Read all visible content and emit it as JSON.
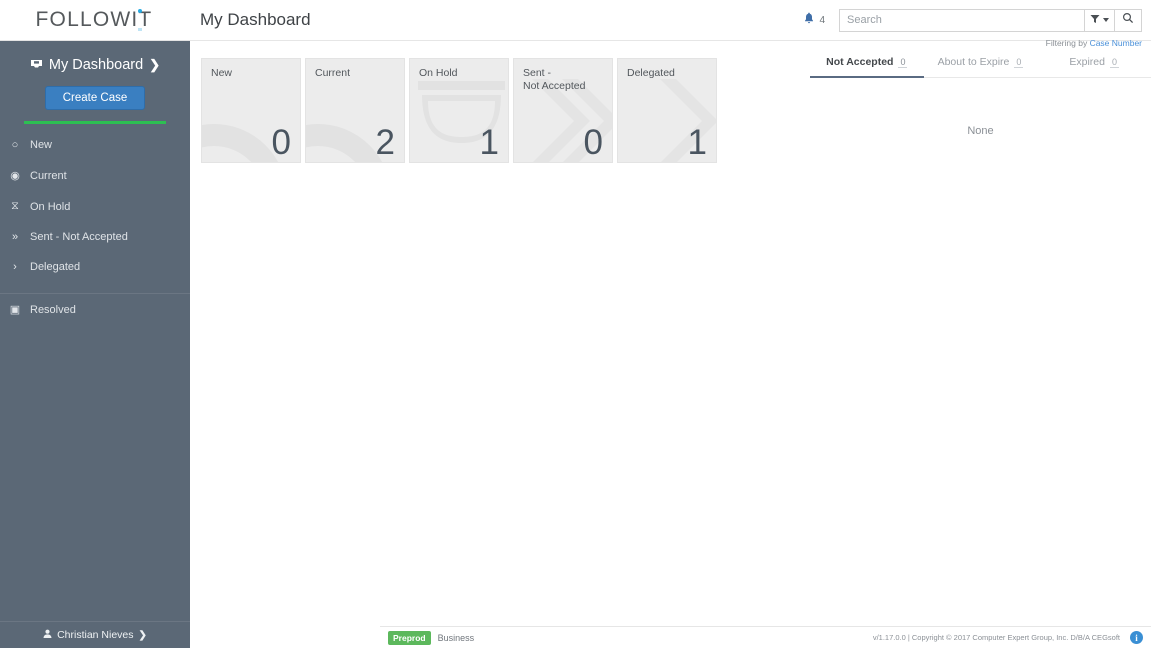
{
  "brand": {
    "logo_text": "FOLLOWIT",
    "accent_color": "#29abe2"
  },
  "sidebar": {
    "dashboard_label": "My Dashboard",
    "dashboard_icon": "inbox-icon",
    "dashboard_chevron": "❯",
    "create_button": "Create Case",
    "items": [
      {
        "label": "New",
        "icon": "circle-outline-icon",
        "glyph": "○"
      },
      {
        "label": "Current",
        "icon": "target-icon",
        "glyph": "◉"
      },
      {
        "label": "On Hold",
        "icon": "hourglass-icon",
        "glyph": "⧖"
      },
      {
        "label": "Sent - Not Accepted",
        "icon": "double-chevron-right-icon",
        "glyph": "»"
      },
      {
        "label": "Delegated",
        "icon": "chevron-right-icon",
        "glyph": "›"
      }
    ],
    "resolved": {
      "label": "Resolved",
      "icon": "archive-box-icon",
      "glyph": "▣"
    },
    "user": {
      "name": "Christian Nieves",
      "icon": "user-icon",
      "chevron": "❯"
    }
  },
  "header": {
    "title": "My Dashboard",
    "notifications": {
      "icon": "bell-icon",
      "count": "4"
    },
    "search": {
      "placeholder": "Search",
      "value": ""
    },
    "filter_button_icon": "funnel-icon",
    "search_button_icon": "search-icon",
    "filtering_prefix": "Filtering by ",
    "filtering_field": "Case Number"
  },
  "cards": [
    {
      "label": "New",
      "value": "0",
      "watermark": "ring-icon"
    },
    {
      "label": "Current",
      "value": "2",
      "watermark": "target-icon"
    },
    {
      "label": "On Hold",
      "value": "1",
      "watermark": "hourglass-icon"
    },
    {
      "label": "Sent -\nNot Accepted",
      "value": "0",
      "watermark": "double-chevron-icon"
    },
    {
      "label": "Delegated",
      "value": "1",
      "watermark": "chevron-icon"
    }
  ],
  "right_panel": {
    "tabs": [
      {
        "label": "Not Accepted",
        "count": "0",
        "active": true
      },
      {
        "label": "About to Expire",
        "count": "0",
        "active": false
      },
      {
        "label": "Expired",
        "count": "0",
        "active": false
      }
    ],
    "empty_text": "None"
  },
  "footer": {
    "env_badge": "Preprod",
    "env_label": "Business",
    "copyright": "v/1.17.0.0 | Copyright © 2017 Computer Expert Group, Inc. D/B/A CEGsoft",
    "info_icon": "info-icon",
    "info_glyph": "i"
  }
}
